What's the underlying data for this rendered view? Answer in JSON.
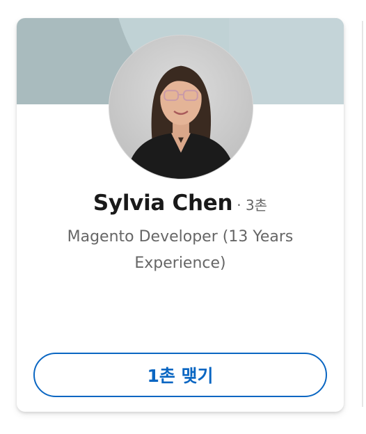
{
  "profile_card": {
    "name": "Sylvia Chen",
    "degree": "· 3촌",
    "headline": "Magento Developer (13 Years Experience)",
    "connect_label": "1촌 맺기"
  },
  "colors": {
    "accent": "#0a66c2",
    "banner": "#a9bbbe",
    "name_text": "#191919",
    "secondary_text": "#666666"
  },
  "icons": {
    "avatar": "profile-photo"
  }
}
